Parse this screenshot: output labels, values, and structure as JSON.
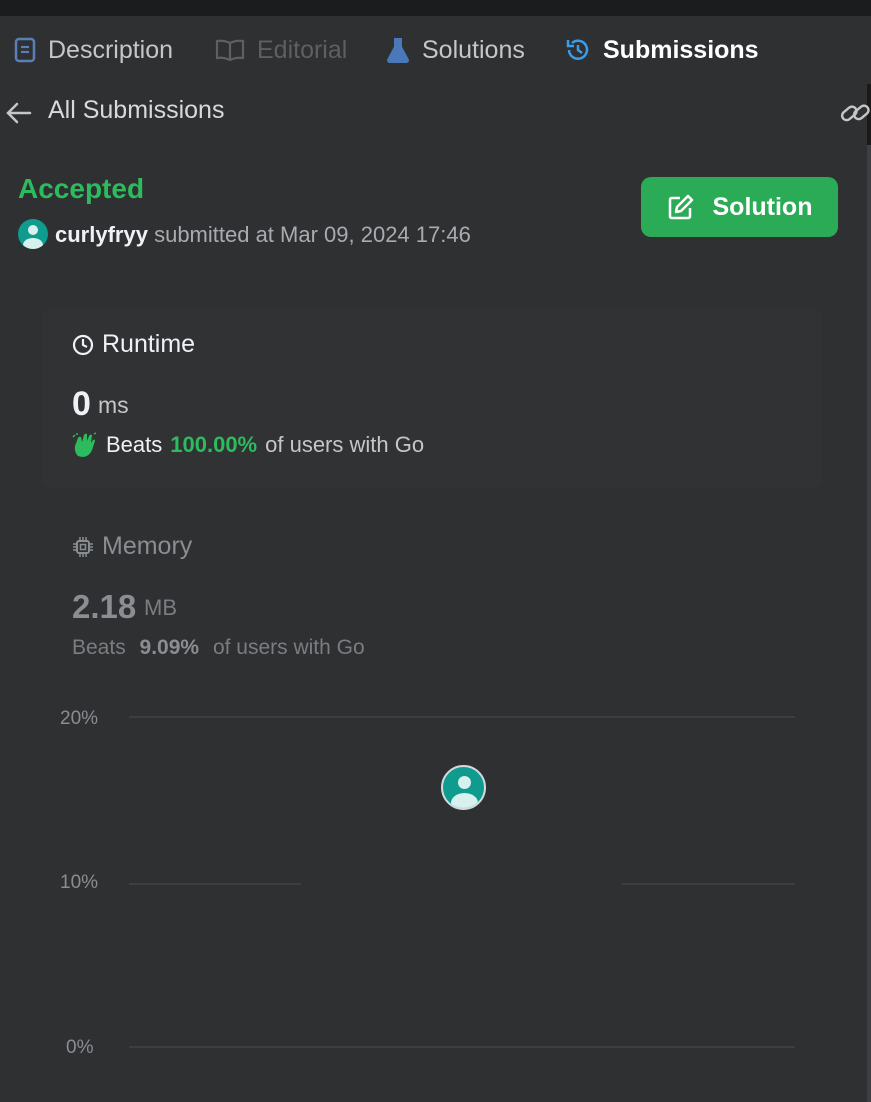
{
  "tabs": [
    {
      "label": "Description",
      "icon": "description-doc-icon",
      "color": "#5a7fb8"
    },
    {
      "label": "Editorial",
      "icon": "book-icon",
      "color": "#5c5f63"
    },
    {
      "label": "Solutions",
      "icon": "flask-icon",
      "color": "#4a78b8"
    },
    {
      "label": "Submissions",
      "icon": "history-icon",
      "color": "#3b9ce8"
    }
  ],
  "back": {
    "label": "All Submissions",
    "icon": "arrow-left-icon"
  },
  "share_icon": "link-icon",
  "submission": {
    "status": "Accepted",
    "status_color": "#2cbb5d",
    "username": "curlyfryy",
    "submitted_text": "submitted at Mar 09, 2024 17:46"
  },
  "solution_button": {
    "label": "Solution",
    "icon": "edit-icon",
    "color": "#2cab57"
  },
  "runtime": {
    "title": "Runtime",
    "icon": "clock-icon",
    "value": "0",
    "unit": "ms",
    "beats_label": "Beats",
    "beats_pct": "100.00%",
    "beats_suffix": "of users with Go",
    "beats_icon": "clap-icon"
  },
  "memory": {
    "title": "Memory",
    "icon": "chip-icon",
    "value": "2.18",
    "unit": "MB",
    "beats_label": "Beats",
    "beats_pct": "9.09%",
    "beats_suffix": "of users with Go"
  },
  "chart_data": {
    "type": "bar",
    "title": "",
    "xlabel": "",
    "ylabel": "",
    "yticks": [
      "20%",
      "10%",
      "0%"
    ],
    "ylim": [
      0,
      20
    ],
    "grid": true,
    "user_marker_pct": 15.7
  }
}
